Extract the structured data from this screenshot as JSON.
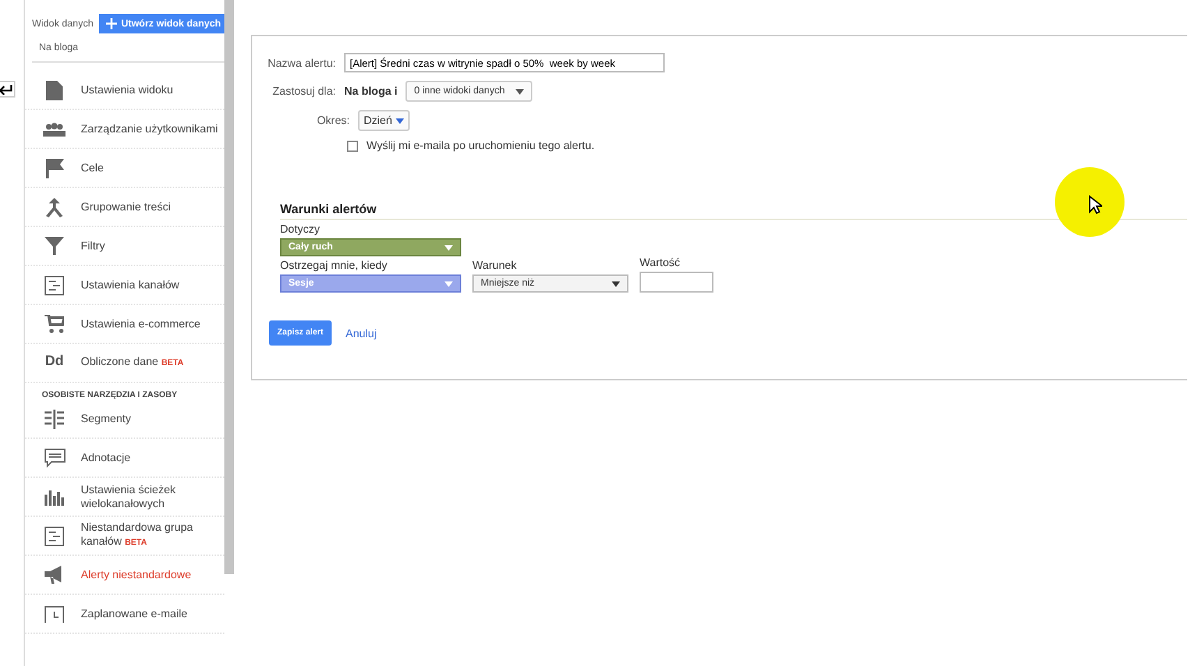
{
  "sidebar": {
    "view_label": "Widok danych",
    "create_button": "Utwórz widok danych",
    "view_name": "Na bloga",
    "items": [
      {
        "label": "Ustawienia widoku",
        "selected": false
      },
      {
        "label": "Zarządzanie użytkownikami",
        "selected": false
      },
      {
        "label": "Cele",
        "selected": false
      },
      {
        "label": "Grupowanie treści",
        "selected": false
      },
      {
        "label": "Filtry",
        "selected": false
      },
      {
        "label": "Ustawienia kanałów",
        "selected": false
      },
      {
        "label": "Ustawienia e-commerce",
        "selected": false
      },
      {
        "label": "Obliczone dane",
        "icon_text": "Dd",
        "badge": "BETA",
        "selected": false
      }
    ],
    "section_title": "OSOBISTE NARZĘDZIA I ZASOBY",
    "personal_items": [
      {
        "label": "Segmenty",
        "selected": false
      },
      {
        "label": "Adnotacje",
        "selected": false
      },
      {
        "label": "Ustawienia ścieżek wielokanałowych",
        "selected": false
      },
      {
        "label": "Niestandardowa grupa kanałów",
        "badge": "BETA",
        "selected": false
      },
      {
        "label": "Alerty niestandardowe",
        "selected": true
      },
      {
        "label": "Zaplanowane e-maile",
        "selected": false
      }
    ]
  },
  "form": {
    "name_label": "Nazwa alertu:",
    "name_value": "[Alert] Średni czas w witrynie spadł o 50%  week by week",
    "apply_label": "Zastosuj dla:",
    "apply_view": "Na bloga i",
    "apply_dropdown": "0 inne widoki danych",
    "period_label": "Okres:",
    "period_value": "Dzień",
    "email_label": "Wyślij mi e-maila po uruchomieniu tego alertu.",
    "email_checked": false,
    "conditions_title": "Warunki alertów",
    "applies_label": "Dotyczy",
    "applies_value": "Cały ruch",
    "alert_when_label": "Ostrzegaj mnie, kiedy",
    "alert_when_value": "Sesje",
    "condition_label": "Warunek",
    "condition_value": "Mniejsze niż",
    "value_label": "Wartość",
    "save_button": "Zapisz alert",
    "cancel_link": "Anuluj"
  }
}
